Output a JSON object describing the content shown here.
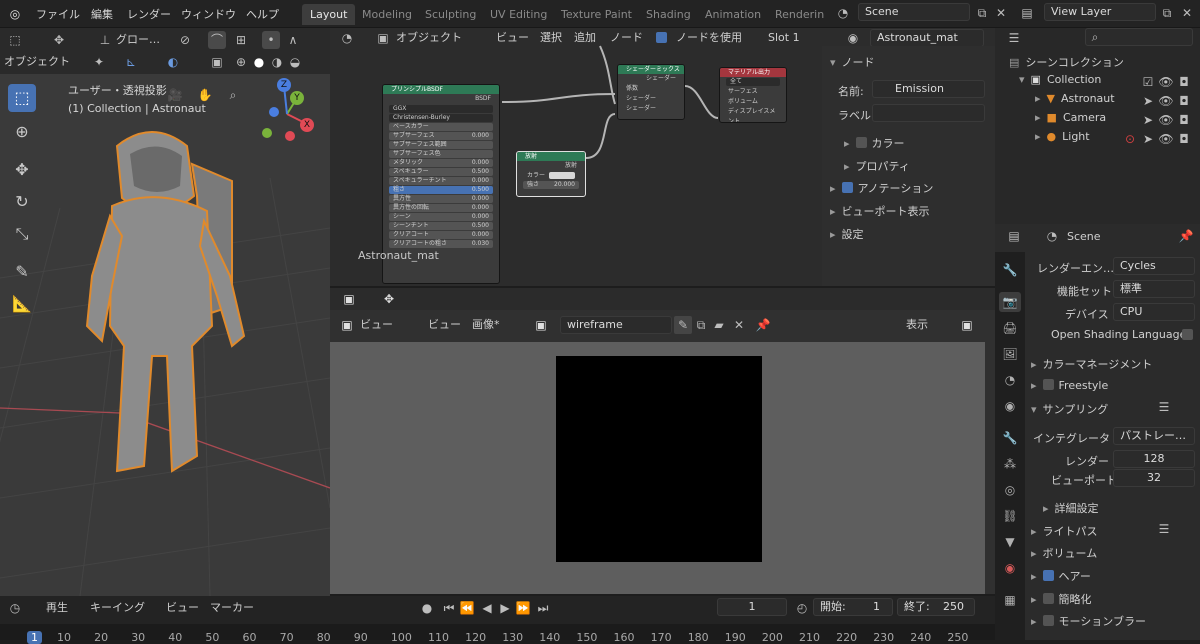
{
  "topbar": {
    "menus": [
      "ファイル",
      "編集",
      "レンダー",
      "ウィンドウ",
      "ヘルプ"
    ],
    "workspaces": [
      "Layout",
      "Modeling",
      "Sculpting",
      "UV Editing",
      "Texture Paint",
      "Shading",
      "Animation",
      "Renderin"
    ],
    "active_workspace": "Layout",
    "scene": "Scene",
    "view_layer": "View Layer"
  },
  "viewport": {
    "transform_orientation": "グロー…",
    "mode": "オブジェクト",
    "view_label": "ユーザー・透視投影",
    "collection_label": "(1) Collection | Astronaut",
    "gizmo": {
      "x": "X",
      "y": "Y",
      "z": "Z"
    }
  },
  "node_editor": {
    "mode": "オブジェクト",
    "menus": [
      "ビュー",
      "選択",
      "追加",
      "ノード"
    ],
    "use_nodes_label": "ノードを使用",
    "slot": "Slot 1",
    "material": "Astronaut_mat",
    "material_label": "Astronaut_mat",
    "nodes": {
      "bsdf": {
        "title": "プリンシプルBSDF",
        "output": "BSDF",
        "dist": "GGX",
        "sss": "Christensen-Burley",
        "rows": [
          {
            "label": "ベースカラー",
            "value": ""
          },
          {
            "label": "サブサーフェス",
            "value": "0.000"
          },
          {
            "label": "サブサーフェス範囲",
            "value": ""
          },
          {
            "label": "サブサーフェス色",
            "value": ""
          },
          {
            "label": "メタリック",
            "value": "0.000"
          },
          {
            "label": "スペキュラー",
            "value": "0.500"
          },
          {
            "label": "スペキュラーチント",
            "value": "0.000"
          },
          {
            "label": "粗さ",
            "value": "0.500"
          },
          {
            "label": "異方性",
            "value": "0.000"
          },
          {
            "label": "異方性の回転",
            "value": "0.000"
          },
          {
            "label": "シーン",
            "value": "0.000"
          },
          {
            "label": "シーンチント",
            "value": "0.500"
          },
          {
            "label": "クリアコート",
            "value": "0.000"
          },
          {
            "label": "クリアコートの粗さ",
            "value": "0.030"
          }
        ]
      },
      "emission": {
        "title": "放射",
        "output": "放射",
        "rows": [
          {
            "label": "カラー",
            "value": ""
          },
          {
            "label": "強さ",
            "value": "20.000"
          }
        ]
      },
      "mix": {
        "title": "シェーダーミックス",
        "output": "シェーダー",
        "rows": [
          "係数",
          "シェーダー",
          "シェーダー"
        ]
      },
      "output": {
        "title": "マテリアル出力",
        "target": "全て",
        "rows": [
          "サーフェス",
          "ボリューム",
          "ディスプレイスメント"
        ]
      }
    },
    "sidebar": {
      "panel": "ノード",
      "name_label": "名前:",
      "name_value": "Emission",
      "label_label": "ラベル",
      "color": "カラー",
      "properties": "プロパティ",
      "annotation": "アノテーション",
      "viewport_display": "ビューポート表示",
      "settings": "設定"
    }
  },
  "image_editor": {
    "view_menu": "ビュー",
    "menus": [
      "ビュー",
      "画像*"
    ],
    "image_name": "wireframe",
    "display_menu": "表示"
  },
  "timeline": {
    "menus": [
      "再生",
      "キーイング",
      "ビュー",
      "マーカー"
    ],
    "current_frame": "1",
    "start_label": "開始:",
    "start": "1",
    "end_label": "終了:",
    "end": "250",
    "ticks": [
      "1",
      "10",
      "20",
      "30",
      "40",
      "50",
      "60",
      "70",
      "80",
      "90",
      "100",
      "110",
      "120",
      "130",
      "140",
      "150",
      "160",
      "170",
      "180",
      "190",
      "200",
      "210",
      "220",
      "230",
      "240",
      "250"
    ]
  },
  "outliner": {
    "title": "シーンコレクション",
    "items": [
      {
        "label": "Collection"
      },
      {
        "label": "Astronaut"
      },
      {
        "label": "Camera"
      },
      {
        "label": "Light"
      }
    ]
  },
  "properties": {
    "context": "Scene",
    "render_engine_label": "レンダーエン…",
    "render_engine": "Cycles",
    "feature_set_label": "機能セット",
    "feature_set": "標準",
    "device_label": "デバイス",
    "device": "CPU",
    "osl_label": "Open Shading Language",
    "color_management": "カラーマネージメント",
    "freestyle": "Freestyle",
    "sampling": "サンプリング",
    "integrator_label": "インテグレータ",
    "integrator": "パストレー…",
    "render_label": "レンダー",
    "render_samples": "128",
    "viewport_label": "ビューポート",
    "viewport_samples": "32",
    "advanced": "詳細設定",
    "light_paths": "ライトパス",
    "volumes": "ボリューム",
    "hair": "ヘアー",
    "simplify": "簡略化",
    "motion_blur": "モーションブラー"
  }
}
